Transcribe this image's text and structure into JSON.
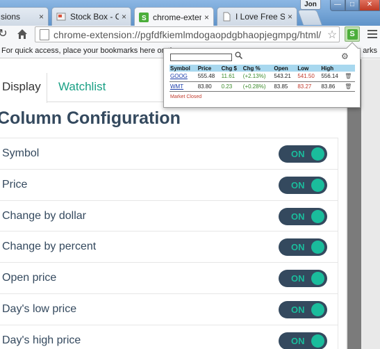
{
  "window": {
    "user": "Jon",
    "controls": {
      "minimize": "—",
      "maximize": "□",
      "close": "✕"
    }
  },
  "tabs": [
    {
      "title": "sions",
      "close": "×"
    },
    {
      "title": "Stock Box - Chr",
      "close": "×"
    },
    {
      "title": "chrome-extensi",
      "close": "×"
    },
    {
      "title": "I Love Free Soft",
      "close": "×"
    }
  ],
  "toolbar": {
    "url": "chrome-extension://pgfdfkiemlmdogaopdgbhaopjegmpg/html/",
    "extension_label": "S"
  },
  "bookmarks_bar": {
    "hint": "For quick access, place your bookmarks here on the",
    "right": "arks"
  },
  "page_tabs": {
    "display": "Display",
    "watchlist": "Watchlist"
  },
  "section_title": "Column Configuration",
  "columns": [
    {
      "label": "Symbol",
      "state": "ON"
    },
    {
      "label": "Price",
      "state": "ON"
    },
    {
      "label": "Change by dollar",
      "state": "ON"
    },
    {
      "label": "Change by percent",
      "state": "ON"
    },
    {
      "label": "Open price",
      "state": "ON"
    },
    {
      "label": "Day's low price",
      "state": "ON"
    },
    {
      "label": "Day's high price",
      "state": "ON"
    }
  ],
  "popup": {
    "search_placeholder": "",
    "headers": [
      "Symbol",
      "Price",
      "Chg $",
      "Chg %",
      "Open",
      "Low",
      "High"
    ],
    "rows": [
      {
        "symbol": "GOOG",
        "price": "555.48",
        "chg": "11.61",
        "chg_pct": "(+2.13%)",
        "open": "543.21",
        "low": "541.50",
        "high": "556.14"
      },
      {
        "symbol": "WMT",
        "price": "83.80",
        "chg": "0.23",
        "chg_pct": "(+0.28%)",
        "open": "83.85",
        "low": "83.27",
        "high": "83.86"
      }
    ],
    "status": "Market Closed"
  },
  "colors": {
    "accent": "#1abc9c",
    "toggle_bg": "#34495e",
    "heading": "#34495e",
    "low_price": "#c0392b",
    "positive_change": "#3a8a2a",
    "popup_header": "#a8d8ef"
  }
}
